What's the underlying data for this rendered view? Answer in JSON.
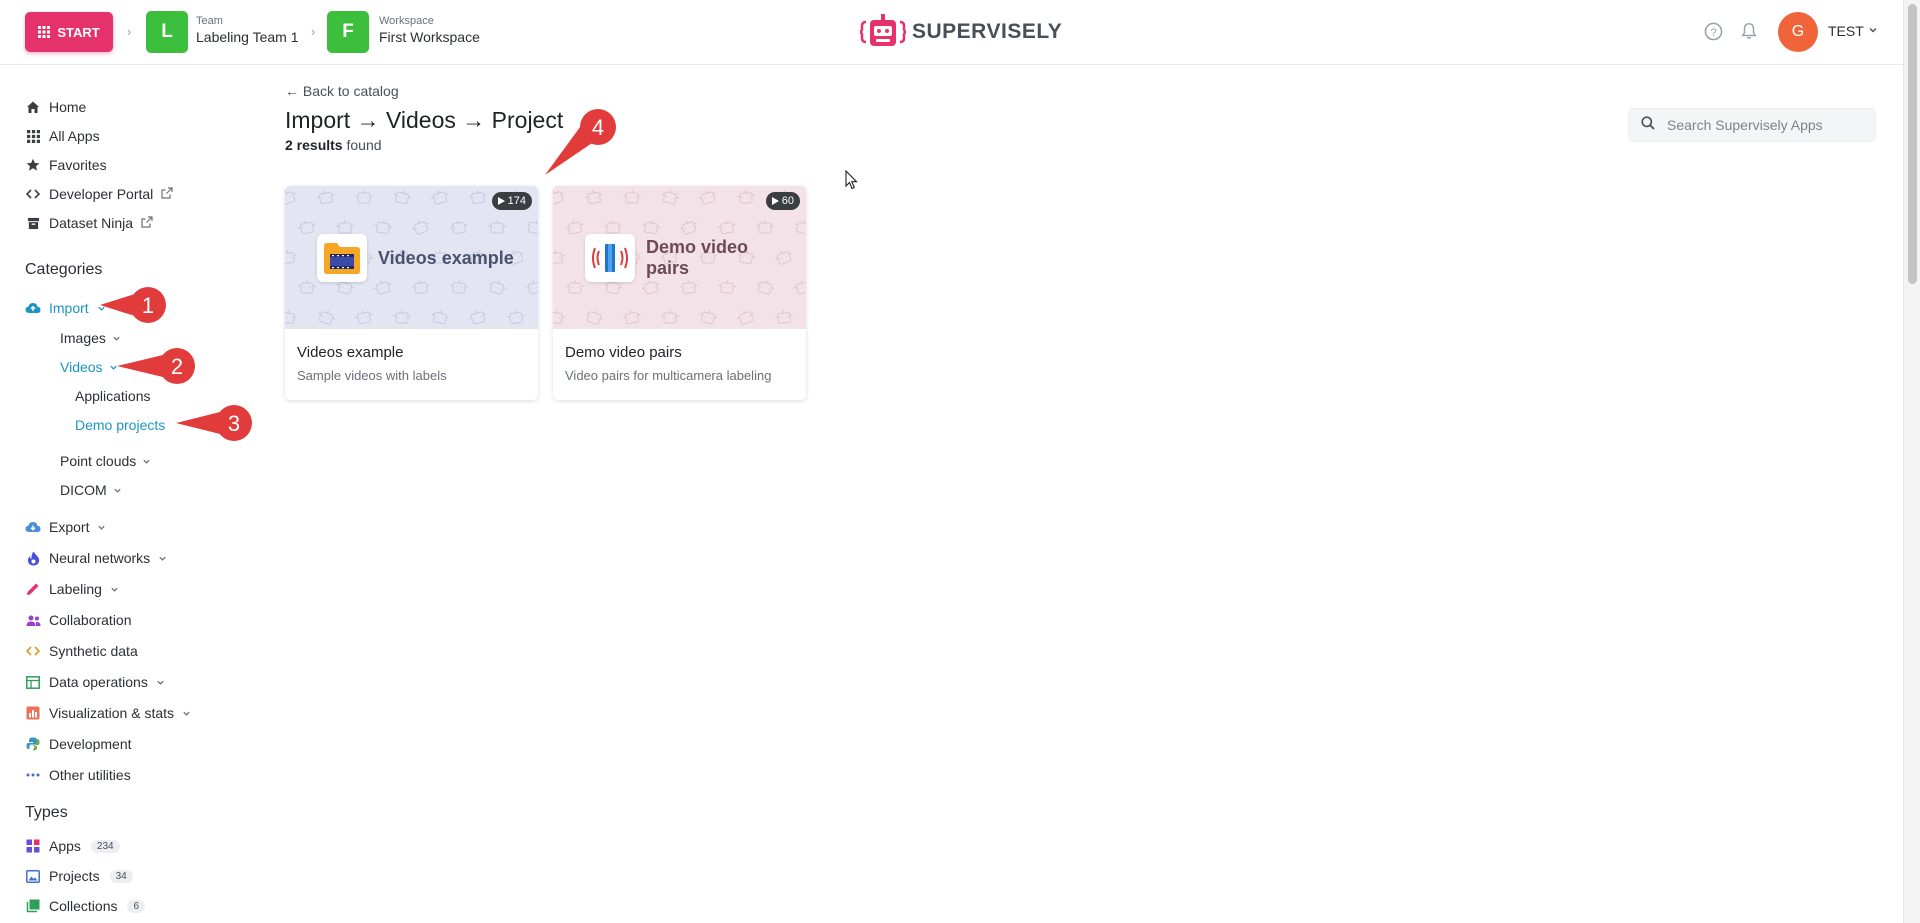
{
  "topbar": {
    "start_label": "START",
    "team": {
      "initial": "L",
      "caption": "Team",
      "name": "Labeling Team 1"
    },
    "workspace": {
      "initial": "F",
      "caption": "Workspace",
      "name": "First Workspace"
    },
    "logo_text": "SUPERVISELY",
    "user_initial": "G",
    "user_name": "TEST"
  },
  "sidebar": {
    "main_items": [
      {
        "label": "Home",
        "icon": "home-icon"
      },
      {
        "label": "All Apps",
        "icon": "grid-icon"
      },
      {
        "label": "Favorites",
        "icon": "star-icon"
      },
      {
        "label": "Developer Portal",
        "icon": "code-icon"
      },
      {
        "label": "Dataset Ninja",
        "icon": "box-icon"
      }
    ],
    "categories_title": "Categories",
    "import_label": "Import",
    "import_sub": {
      "images": "Images",
      "videos": "Videos",
      "applications": "Applications",
      "demo_projects": "Demo projects",
      "point_clouds": "Point clouds",
      "dicom": "DICOM"
    },
    "categories": [
      {
        "label": "Export",
        "icon": "cloud-icon",
        "chevron": true
      },
      {
        "label": "Neural networks",
        "icon": "flame-icon",
        "chevron": true
      },
      {
        "label": "Labeling",
        "icon": "pencil-icon",
        "chevron": true
      },
      {
        "label": "Collaboration",
        "icon": "people-icon",
        "chevron": false
      },
      {
        "label": "Synthetic data",
        "icon": "code-icon",
        "chevron": false
      },
      {
        "label": "Data operations",
        "icon": "table-icon",
        "chevron": true
      },
      {
        "label": "Visualization & stats",
        "icon": "chart-icon",
        "chevron": true
      },
      {
        "label": "Development",
        "icon": "python-icon",
        "chevron": false
      },
      {
        "label": "Other utilities",
        "icon": "dots-icon",
        "chevron": false
      }
    ],
    "types_title": "Types",
    "types": [
      {
        "label": "Apps",
        "count": "234"
      },
      {
        "label": "Projects",
        "count": "34"
      },
      {
        "label": "Collections",
        "count": "6"
      }
    ]
  },
  "main": {
    "back_link": "← Back to catalog",
    "title": "Import → Videos → Project",
    "results_count": "2 results",
    "results_suffix": " found",
    "search_placeholder": "Search Supervisely Apps",
    "cards": [
      {
        "banner_title": "Videos example",
        "count": "174",
        "title": "Videos example",
        "description": "Sample videos with labels",
        "banner_color": "#e3e6f2",
        "title_color": "#4a5270"
      },
      {
        "banner_title": "Demo video pairs",
        "count": "60",
        "title": "Demo video pairs",
        "description": "Video pairs for multicamera labeling",
        "banner_color": "#f3e3e8",
        "title_color": "#6e4a57"
      }
    ]
  },
  "annotations": [
    "1",
    "2",
    "3",
    "4"
  ],
  "colors": {
    "start": "#e5326d",
    "team_green": "#3cbf3c",
    "active_link": "#1b96c2",
    "marker_red": "#e23b3b"
  }
}
